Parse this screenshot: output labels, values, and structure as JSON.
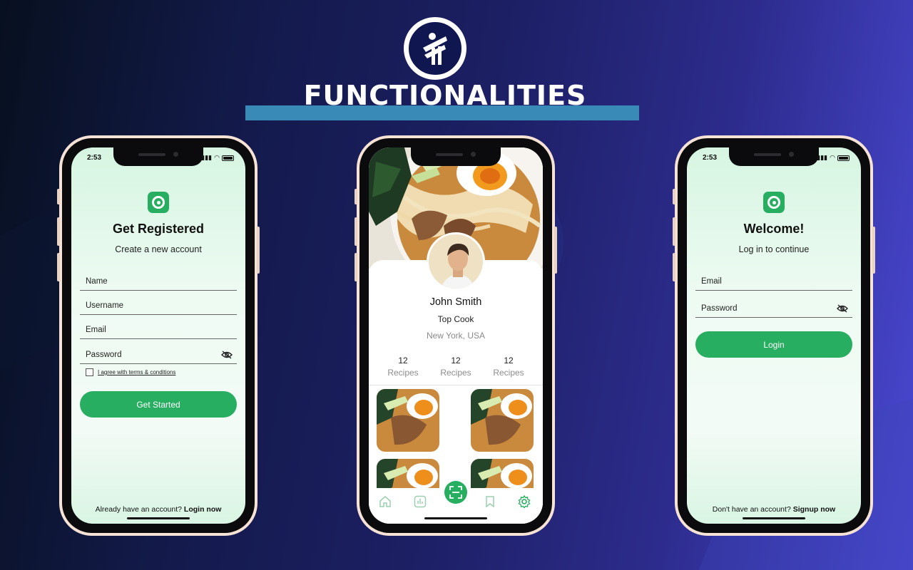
{
  "header": {
    "title": "FUNCTIONALITIES",
    "logo_icon": "brand-figure-logo-icon"
  },
  "colors": {
    "accent_green": "#27ae60",
    "title_bar": "#3a8ab8",
    "phone_frame": "#f6e3d6"
  },
  "register": {
    "status_time": "2:53",
    "title": "Get Registered",
    "subtitle": "Create a new account",
    "fields": [
      "Name",
      "Username",
      "Email",
      "Password"
    ],
    "terms_label": "I agree with terms & conditions",
    "button_label": "Get Started",
    "footer_prefix": "Already have an account?",
    "footer_link": "Login now"
  },
  "profile": {
    "name": "John Smith",
    "role": "Top Cook",
    "location": "New York, USA",
    "stats": [
      {
        "value": "12",
        "label": "Recipes"
      },
      {
        "value": "12",
        "label": "Recipes"
      },
      {
        "value": "12",
        "label": "Recipes"
      }
    ],
    "tab_icons": [
      "home-icon",
      "stats-icon",
      "scan-icon",
      "bookmark-icon",
      "settings-icon"
    ]
  },
  "login": {
    "status_time": "2:53",
    "title": "Welcome!",
    "subtitle": "Log in to continue",
    "fields": [
      "Email",
      "Password"
    ],
    "button_label": "Login",
    "footer_prefix": "Don't have an account?",
    "footer_link": "Signup now"
  }
}
